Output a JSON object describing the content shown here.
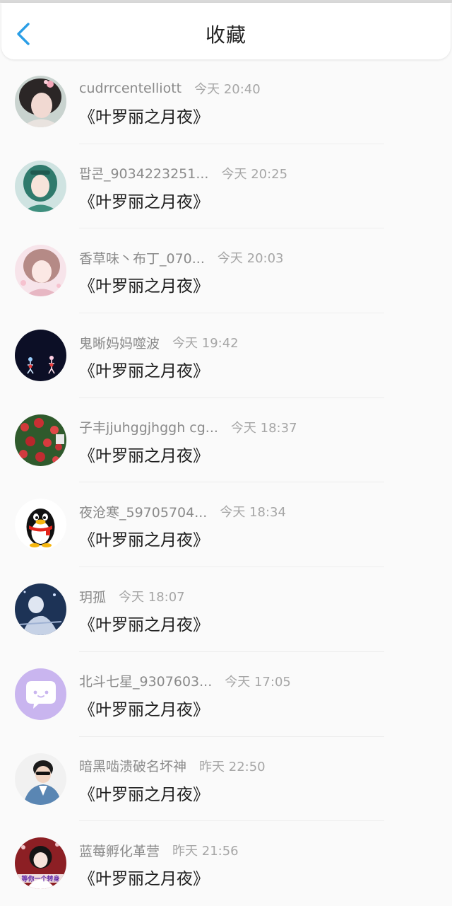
{
  "header": {
    "title": "收藏",
    "back_icon": "chevron-left-icon",
    "accent": "#2a9ee6"
  },
  "items": [
    {
      "name": "cudrrcentelliott",
      "time": "今天 20:40",
      "work": "《叶罗丽之月夜》",
      "avatar": "girl-flower-avatar"
    },
    {
      "name": "팝콘_9034223251...",
      "time": "今天 20:25",
      "work": "《叶罗丽之月夜》",
      "avatar": "green-hair-girl-avatar"
    },
    {
      "name": "香草味丶布丁_070...",
      "time": "今天 20:03",
      "work": "《叶罗丽之月夜》",
      "avatar": "pink-anime-girl-avatar"
    },
    {
      "name": "鬼晰妈妈噬波",
      "time": "今天 19:42",
      "work": "《叶罗丽之月夜》",
      "avatar": "night-couple-avatar"
    },
    {
      "name": "子丰jjuhggjhggh cg...",
      "time": "今天 18:37",
      "work": "《叶罗丽之月夜》",
      "avatar": "red-roses-avatar"
    },
    {
      "name": "夜沧寒_59705704...",
      "time": "今天 18:34",
      "work": "《叶罗丽之月夜》",
      "avatar": "qq-penguin-avatar"
    },
    {
      "name": "玥孤",
      "time": "今天 18:07",
      "work": "《叶罗丽之月夜》",
      "avatar": "night-boy-avatar"
    },
    {
      "name": "北斗七星_9307603...",
      "time": "今天 17:05",
      "work": "《叶罗丽之月夜》",
      "avatar": "purple-chat-bubble-avatar"
    },
    {
      "name": "暗黑啮溃破名坏神",
      "time": "昨天 22:50",
      "work": "《叶罗丽之月夜》",
      "avatar": "boy-denim-avatar"
    },
    {
      "name": "蓝莓孵化革营",
      "time": "昨天 21:56",
      "work": "《叶罗丽之月夜》",
      "avatar": "girl-red-bg-avatar",
      "avatar_caption": "等你一个转身"
    }
  ]
}
